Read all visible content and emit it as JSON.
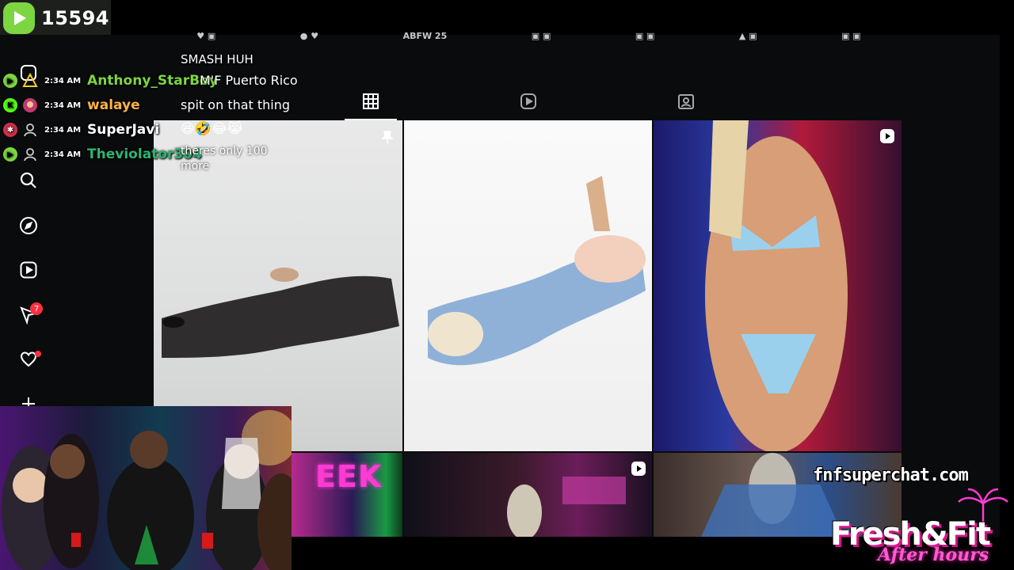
{
  "viewer_badge": {
    "count": "15594",
    "color": "#7cd640"
  },
  "top_strip": {
    "items": [
      "♥ ▣",
      "● ♥",
      "ABFW 25",
      "▣ ▣",
      "▣ ▣",
      "▲ ▣",
      "▣ ▣"
    ]
  },
  "chat": {
    "messages": [
      {
        "platform": "rumble",
        "time": "2:34 AM",
        "user": "Anthony_StarBoy",
        "user_color": "#7cd640",
        "text": "M'F Puerto Rico"
      },
      {
        "platform": "kick",
        "time": "2:34 AM",
        "user": "walaye",
        "user_color": "#ffb347",
        "text": "spit on that thing"
      },
      {
        "platform": "other",
        "time": "2:34 AM",
        "user": "SuperJavi",
        "user_color": "#ffffff",
        "text": "😆🤣😂😹"
      },
      {
        "platform": "rumble",
        "time": "2:34 AM",
        "user": "Theviolator304",
        "user_color": "#2bb673",
        "text": "theres only 100 more"
      }
    ],
    "partial_top": "SMASH HUH"
  },
  "profile_tabs": [
    "posts-grid",
    "reels",
    "tagged"
  ],
  "sidebar": {
    "notification_count": "7"
  },
  "tile4_text": "EEK",
  "branding": {
    "superchat": "fnfsuperchat.com",
    "logo": "Fresh&Fit",
    "logo_sub": "After hours"
  }
}
